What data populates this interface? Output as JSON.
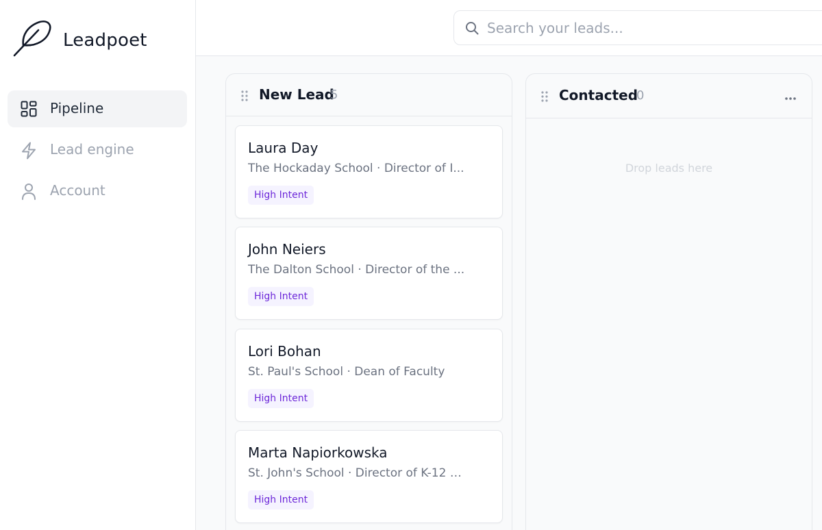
{
  "brand": {
    "name": "Leadpoet",
    "logo_icon": "feather-icon"
  },
  "sidebar": {
    "items": [
      {
        "label": "Pipeline",
        "icon": "grid-icon",
        "active": true
      },
      {
        "label": "Lead engine",
        "icon": "bolt-icon",
        "active": false
      },
      {
        "label": "Account",
        "icon": "user-icon",
        "active": false
      }
    ]
  },
  "search": {
    "placeholder": "Search your leads...",
    "value": ""
  },
  "board": {
    "columns": [
      {
        "title": "New Lead",
        "count": "5",
        "cards": [
          {
            "name": "Laura Day",
            "subtitle": "The Hockaday School · Director of I...",
            "badge": "High Intent"
          },
          {
            "name": "John Neiers",
            "subtitle": "The Dalton School · Director of the ...",
            "badge": "High Intent"
          },
          {
            "name": "Lori Bohan",
            "subtitle": "St. Paul's School · Dean of Faculty",
            "badge": "High Intent"
          },
          {
            "name": "Marta Napiorkowska",
            "subtitle": "St. John's School · Director of K-12 C...",
            "badge": "High Intent"
          }
        ]
      },
      {
        "title": "Contacted",
        "count": "0",
        "empty_text": "Drop leads here",
        "cards": []
      }
    ]
  },
  "colors": {
    "accent_badge_bg": "#f5f3ff",
    "accent_badge_text": "#6d28d9",
    "border": "#e5e7eb",
    "muted_text": "#9ca3af"
  }
}
